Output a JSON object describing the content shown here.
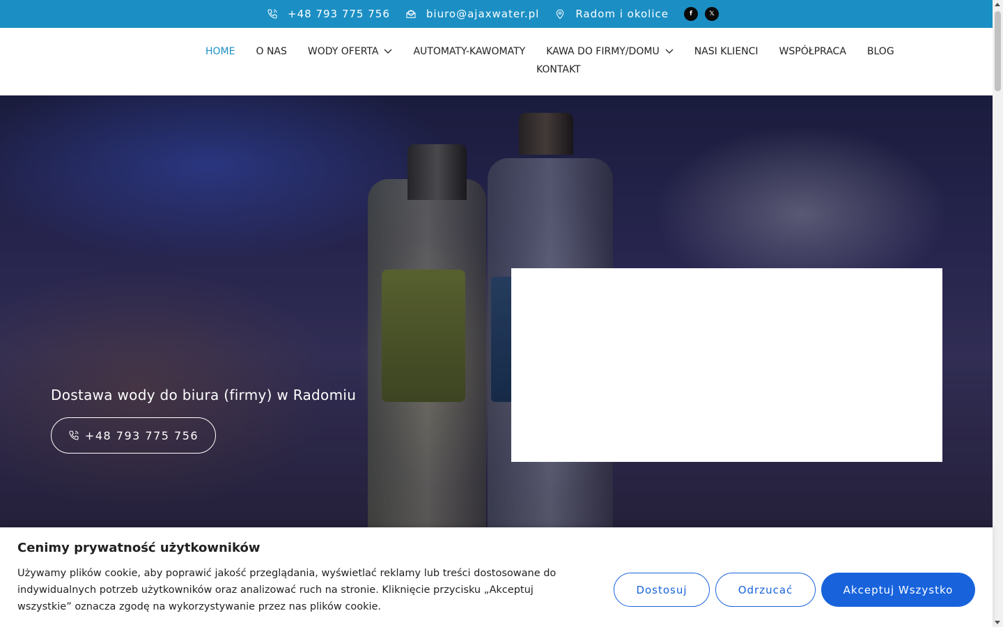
{
  "topbar": {
    "phone": "+48 793 775 756",
    "email": "biuro@ajaxwater.pl",
    "location": "Radom i okolice",
    "social": [
      {
        "icon": "facebook-icon"
      },
      {
        "icon": "x-twitter-icon"
      }
    ],
    "background": "#1b8fc4"
  },
  "nav": {
    "items": [
      {
        "label": "HOME"
      },
      {
        "label": "O NAS"
      },
      {
        "label": "WODY OFERTA"
      },
      {
        "label": "AUTOMATY-KAWOMATY"
      },
      {
        "label": "KAWA DO FIRMY/DOMU"
      },
      {
        "label": "NASI KLIENCI"
      },
      {
        "label": "WSPÓŁPRACA"
      },
      {
        "label": "BLOG"
      },
      {
        "label": "KONTAKT"
      }
    ],
    "active_color": "#1b8fc4"
  },
  "hero": {
    "title": "Dostawa wody do biura (firmy) w Radomiu",
    "button_label": "+48 793 775 756"
  },
  "cookie": {
    "title": "Cenimy prywatność użytkowników",
    "text": "Używamy plików cookie, aby poprawić jakość przeglądania, wyświetlać reklamy lub treści dostosowane do indywidualnych potrzeb użytkowników oraz analizować ruch na stronie. Kliknięcie przycisku „Akceptuj wszystkie” oznacza zgodę na wykorzystywanie przez nas plików cookie.",
    "customize_label": "Dostosuj",
    "reject_label": "Odrzucać",
    "accept_label": "Akceptuj Wszystko",
    "accent": "#1863dc"
  }
}
